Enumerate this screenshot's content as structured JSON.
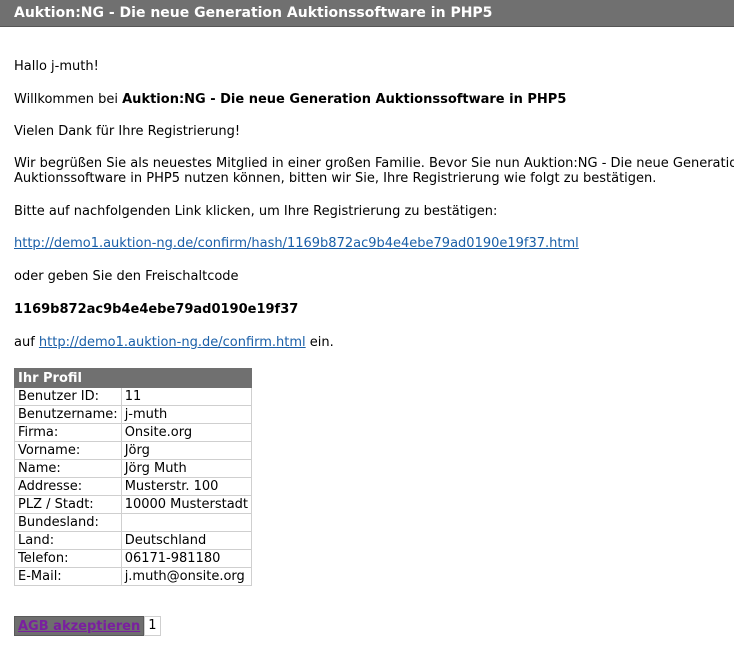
{
  "header": {
    "title": "Auktion:NG - Die neue Generation Auktionssoftware in PHP5"
  },
  "email": {
    "greeting": "Hallo j-muth!",
    "welcome_prefix": "Willkommen bei ",
    "welcome_name": "Auktion:NG - Die neue Generation Auktionssoftware in PHP5",
    "thanks": "Vielen Dank für Ihre Registrierung!",
    "intro_line1": "Wir begrüßen Sie als neuestes Mitglied in einer großen Familie. Bevor Sie nun Auktion:NG - Die neue Generation",
    "intro_line2": "Auktionssoftware in PHP5 nutzen können, bitten wir Sie, Ihre Registrierung wie folgt zu bestätigen.",
    "click_instruction": "Bitte auf nachfolgenden Link klicken, um Ihre Registrierung zu bestätigen:",
    "confirm_link": "http://demo1.auktion-ng.de/confirm/hash/1169b872ac9b4e4ebe79ad0190e19f37.html",
    "or_code": "oder geben Sie den Freischaltcode",
    "code": "1169b872ac9b4e4ebe79ad0190e19f37",
    "on_prefix": "auf ",
    "confirm_page_link": "http://demo1.auktion-ng.de/confirm.html",
    "on_suffix": " ein."
  },
  "profile": {
    "heading": "Ihr Profil",
    "rows": [
      {
        "label": "Benutzer ID:",
        "value": "11"
      },
      {
        "label": "Benutzername:",
        "value": "j-muth"
      },
      {
        "label": "Firma:",
        "value": "Onsite.org"
      },
      {
        "label": "Vorname:",
        "value": "Jörg"
      },
      {
        "label": "Name:",
        "value": "Jörg Muth"
      },
      {
        "label": "Addresse:",
        "value": "Musterstr. 100"
      },
      {
        "label": "PLZ / Stadt:",
        "value": "10000 Musterstadt"
      },
      {
        "label": "Bundesland:",
        "value": ""
      },
      {
        "label": "Land:",
        "value": "Deutschland"
      },
      {
        "label": "Telefon:",
        "value": "06171-981180"
      },
      {
        "label": "E-Mail:",
        "value": "j.muth@onsite.org"
      }
    ]
  },
  "accept": {
    "label": "AGB akzeptieren",
    "value": "1"
  },
  "colors": {
    "header_bg": "#707070",
    "link": "#1a5fa8",
    "visited_link": "#7a1fa0"
  }
}
